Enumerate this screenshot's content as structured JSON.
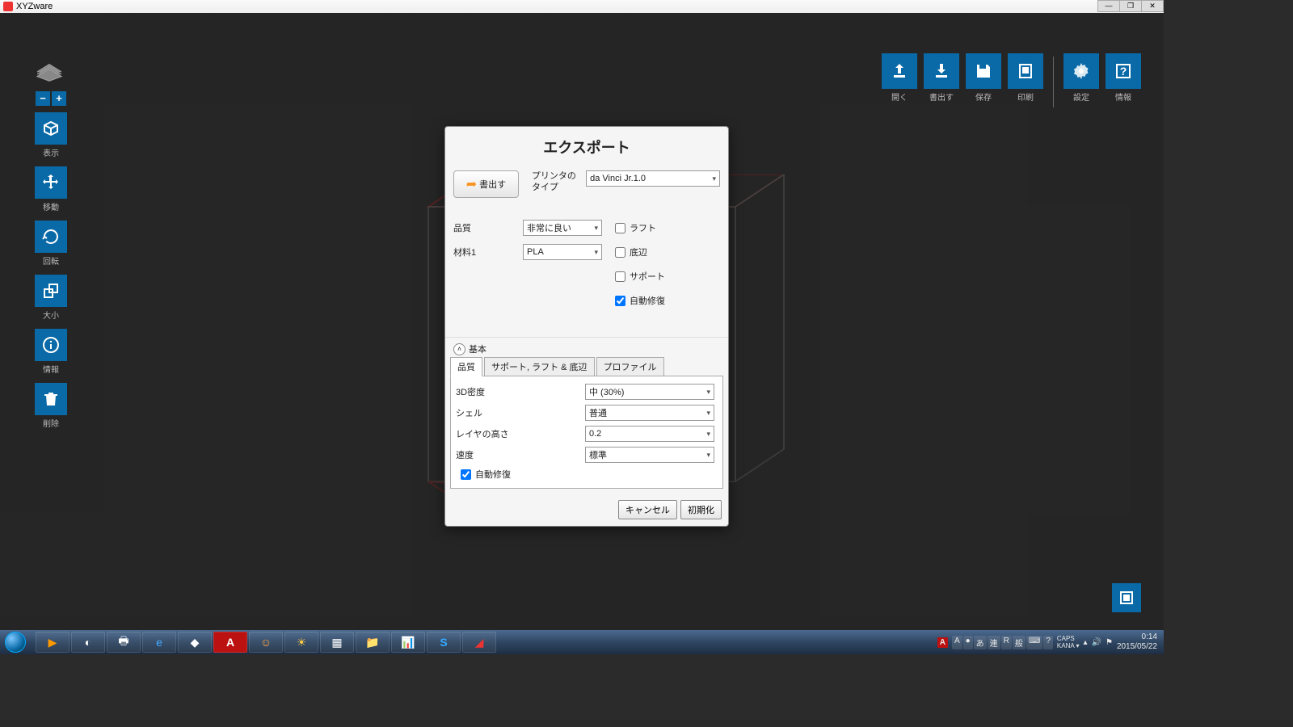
{
  "window": {
    "title": "XYZware"
  },
  "left_toolbar": {
    "minus": "−",
    "plus": "+",
    "view": "表示",
    "move": "移動",
    "rotate": "回転",
    "scale": "大小",
    "info": "情報",
    "delete": "削除"
  },
  "right_toolbar": {
    "open": "開く",
    "export": "書出す",
    "save": "保存",
    "print": "印刷",
    "settings": "設定",
    "about": "情報"
  },
  "dialog": {
    "title": "エクスポート",
    "export_btn": "書出す",
    "printer_type_lbl": "プリンタのタイプ",
    "printer_type": "da Vinci Jr.1.0",
    "quality_lbl": "品質",
    "quality": "非常に良い",
    "material_lbl": "材料1",
    "material": "PLA",
    "chk_raft": "ラフト",
    "chk_brim": "底辺",
    "chk_support": "サポート",
    "chk_autorepair": "自動修復",
    "basic": "基本",
    "tab_quality": "品質",
    "tab_support": "サポート, ラフト & 底辺",
    "tab_profile": "プロファイル",
    "density_lbl": "3D密度",
    "density": "中 (30%)",
    "shell_lbl": "シェル",
    "shell": "普通",
    "layer_lbl": "レイヤの高さ",
    "layer": "0.2",
    "speed_lbl": "速度",
    "speed": "標準",
    "chk_autorepair2": "自動修復",
    "cancel": "キャンセル",
    "reset": "初期化"
  },
  "taskbar": {
    "ime": [
      "A",
      "●",
      "あ",
      "連",
      "R",
      "般",
      "⌨",
      "?"
    ],
    "caps": "CAPS",
    "kana": "KANA ▾",
    "time": "0:14",
    "date": "2015/05/22"
  }
}
